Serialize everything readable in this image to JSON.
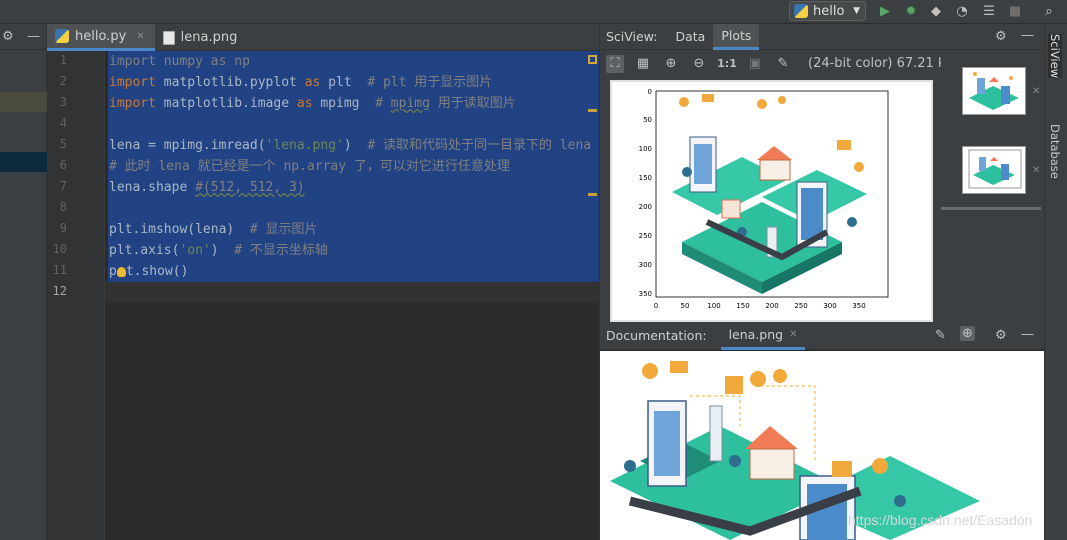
{
  "toolbar": {
    "run_config": "hello",
    "colors": {
      "run": "#59a869",
      "debug": "#4c9e4c",
      "stop": "#6e6e6e"
    }
  },
  "editor": {
    "tabs": [
      {
        "label": "hello.py",
        "active": true
      },
      {
        "label": "lena.png",
        "active": false
      }
    ],
    "line_numbers": [
      "1",
      "2",
      "3",
      "4",
      "5",
      "6",
      "7",
      "8",
      "9",
      "10",
      "11",
      "12"
    ],
    "current_line": "12",
    "code": {
      "l1_import": "import",
      "l1_rest": " numpy ",
      "l1_as": "as",
      "l1_alias": " np",
      "l2_import": "import",
      "l2_mod": " matplotlib.pyplot ",
      "l2_as": "as",
      "l2_alias": " plt  ",
      "l2_comment": "# plt 用于显示图片",
      "l3_import": "import",
      "l3_mod": " matplotlib.image ",
      "l3_as": "as",
      "l3_alias": " mpimg  ",
      "l3_comment_a": "# ",
      "l3_comment_mpimg": "mpimg",
      "l3_comment_b": " 用于读取图片",
      "l5_code_a": "lena = mpimg.imread(",
      "l5_str": "'lena.png'",
      "l5_code_b": ")  ",
      "l5_comment": "# 读取和代码处于同一目录下的 lena",
      "l6_comment": "# 此时 lena 就已经是一个 np.array 了，可以对它进行任意处理",
      "l7_code": "lena.shape ",
      "l7_comment": "#(512, 512, 3)",
      "l9_code": "plt.imshow(lena)  ",
      "l9_comment": "# 显示图片",
      "l10_code_a": "plt.axis(",
      "l10_str": "'on'",
      "l10_code_b": ")  ",
      "l10_comment": "# 不显示坐标轴",
      "l11_a": "p",
      "l11_b": "t.show()"
    }
  },
  "sciview": {
    "title": "SciView:",
    "tabs": [
      "Data",
      "Plots"
    ],
    "active_tab": "Plots",
    "zoom_label": "1:1",
    "image_info": "(24-bit color) 67.21 kB",
    "plot": {
      "y_ticks": [
        "0",
        "50",
        "100",
        "150",
        "200",
        "250",
        "300",
        "350"
      ],
      "x_ticks": [
        "0",
        "50",
        "100",
        "150",
        "200",
        "250",
        "300",
        "350"
      ]
    }
  },
  "documentation": {
    "title": "Documentation:",
    "tab": "lena.png"
  },
  "right_strip": {
    "sciview_label": "SciView",
    "database_label": "Database"
  },
  "watermark": "https://blog.csdn.net/Easadon"
}
